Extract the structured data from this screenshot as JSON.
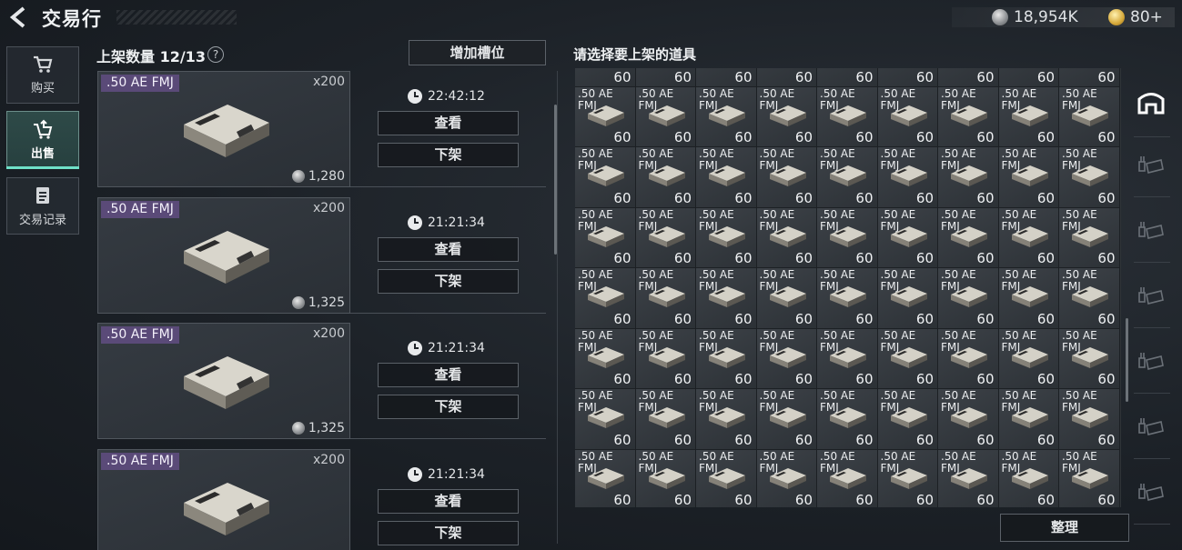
{
  "header": {
    "title": "交易行",
    "silver_amount": "18,954K",
    "gold_amount": "80+"
  },
  "sidebar": {
    "items": [
      {
        "label": "购买",
        "icon": "cart-icon"
      },
      {
        "label": "出售",
        "icon": "sell-basket-icon"
      },
      {
        "label": "交易记录",
        "icon": "record-icon"
      }
    ],
    "active_index": 1
  },
  "listings": {
    "header": "上架数量 12/13",
    "help": "?",
    "add_slot_label": "增加槽位",
    "items": [
      {
        "name": ".50 AE FMJ",
        "qty": "x200",
        "price": "1,280",
        "timer": "22:42:12",
        "view_label": "查看",
        "delist_label": "下架"
      },
      {
        "name": ".50 AE FMJ",
        "qty": "x200",
        "price": "1,325",
        "timer": "21:21:34",
        "view_label": "查看",
        "delist_label": "下架"
      },
      {
        "name": ".50 AE FMJ",
        "qty": "x200",
        "price": "1,325",
        "timer": "21:21:34",
        "view_label": "查看",
        "delist_label": "下架"
      },
      {
        "name": ".50 AE FMJ",
        "qty": "x200",
        "price": "",
        "timer": "21:21:34",
        "view_label": "查看",
        "delist_label": "下架"
      }
    ]
  },
  "inventory": {
    "header": "请选择要上架的道具",
    "item_name": ".50 AE FMJ",
    "item_count": "60",
    "rows": 8,
    "cols": 9,
    "sort_label": "整理"
  },
  "colors": {
    "accent": "#6fe0c8",
    "item_tag": "#5a4a78",
    "panel": "#2a2f35"
  }
}
